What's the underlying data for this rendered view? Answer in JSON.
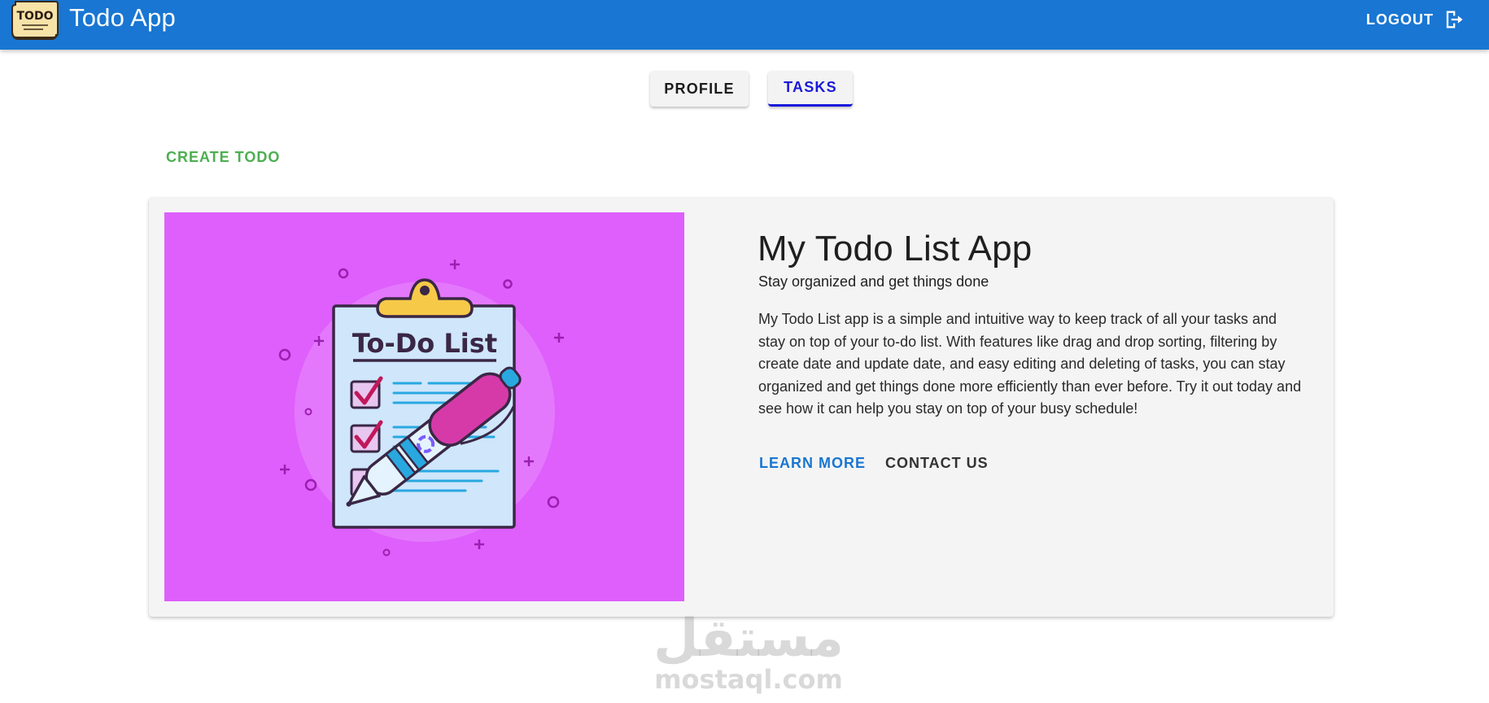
{
  "appbar": {
    "logo_text": "TODO",
    "title": "Todo App",
    "logout_label": "LOGOUT",
    "background_color": "#1976d2"
  },
  "tabs": [
    {
      "label": "PROFILE",
      "active": false
    },
    {
      "label": "TASKS",
      "active": true
    }
  ],
  "create_todo_label": "CREATE TODO",
  "card": {
    "image_title": "To-Do List",
    "title": "My Todo List App",
    "subtitle": "Stay organized and get things done",
    "body": "My Todo List app is a simple and intuitive way to keep track of all your tasks and stay on top of your to-do list. With features like drag and drop sorting, filtering by create date and update date, and easy editing and deleting of tasks, you can stay organized and get things done more efficiently than ever before. Try it out today and see how it can help you stay on top of your busy schedule!",
    "actions": {
      "learn_more": "LEARN MORE",
      "contact_us": "CONTACT US"
    },
    "image_background": "#de5ffc"
  },
  "watermark": {
    "arabic": "مستقل",
    "latin": "mostaql.com"
  },
  "icons": {
    "logout": "logout-icon",
    "logo": "todo-note-icon"
  },
  "colors": {
    "accent": "#1976d2",
    "success": "#4caf50",
    "tab_active": "#1a1adb"
  }
}
